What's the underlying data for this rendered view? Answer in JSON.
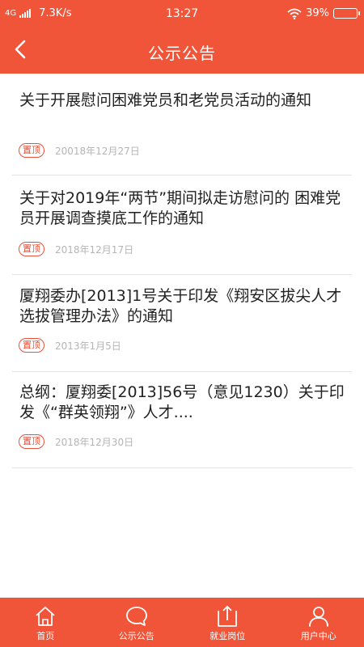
{
  "status_bar": {
    "network": "4G",
    "speed": "7.3K/s",
    "time": "13:27",
    "battery": "39%",
    "battery_level": 0.39
  },
  "nav": {
    "title": "公示公告"
  },
  "notices": [
    {
      "title": "关于开展慰问困难党员和老党员活动的通知",
      "badge": "置顶",
      "date": "20018年12月27日"
    },
    {
      "title": "关于对2019年“两节”期间拟走访慰问的 困难党员开展调查摸底工作的通知",
      "badge": "置顶",
      "date": "2018年12月17日"
    },
    {
      "title": "厦翔委办[2013]1号关于印发《翔安区拔尖人才选拔管理办法》的通知",
      "badge": "置顶",
      "date": "2013年1月5日"
    },
    {
      "title": "总纲：厦翔委[2013]56号（意见1230）关于印发《“群英领翔”》人才....",
      "badge": "置顶",
      "date": "2018年12月30日"
    }
  ],
  "tabbar": {
    "items": [
      {
        "label": "首页",
        "icon": "home-icon"
      },
      {
        "label": "公示公告",
        "icon": "chat-bubble-icon"
      },
      {
        "label": "就业岗位",
        "icon": "upload-icon"
      },
      {
        "label": "用户中心",
        "icon": "user-icon"
      }
    ]
  },
  "colors": {
    "accent": "#f0553a",
    "badge": "#e8513a",
    "date": "#b5b5b5"
  }
}
